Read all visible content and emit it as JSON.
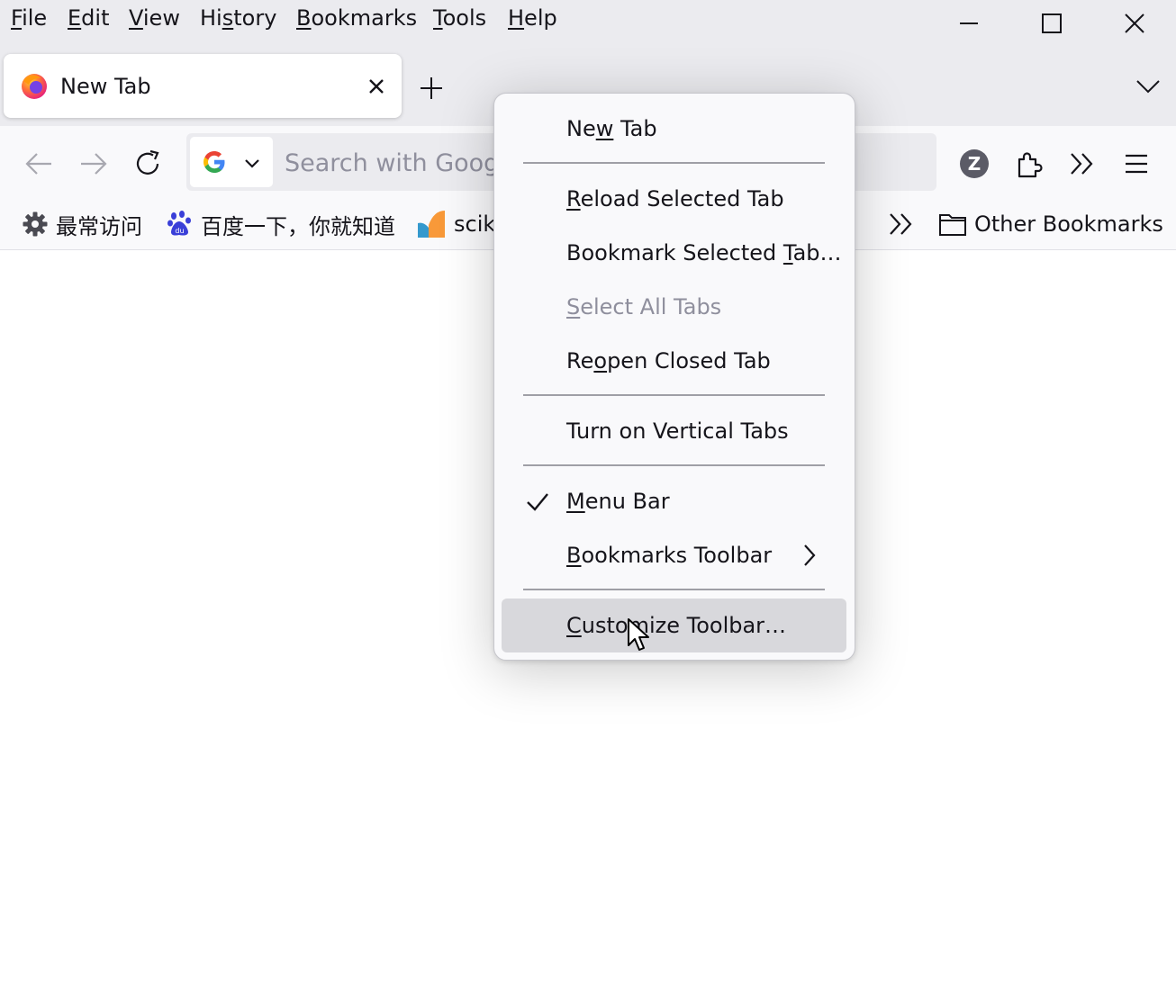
{
  "menubar": {
    "items": [
      {
        "pre": "",
        "u": "F",
        "post": "ile"
      },
      {
        "pre": "",
        "u": "E",
        "post": "dit"
      },
      {
        "pre": "",
        "u": "V",
        "post": "iew"
      },
      {
        "pre": "Hi",
        "u": "s",
        "post": "tory"
      },
      {
        "pre": "",
        "u": "B",
        "post": "ookmarks"
      },
      {
        "pre": "",
        "u": "T",
        "post": "ools"
      },
      {
        "pre": "",
        "u": "H",
        "post": "elp"
      }
    ]
  },
  "tab": {
    "title": "New Tab",
    "icon": "firefox-icon"
  },
  "navbar": {
    "search_placeholder": "Search with Google or enter address",
    "extension_avatar": "Z"
  },
  "bookmarks": {
    "items": [
      {
        "label": "最常访问",
        "icon": "gear-icon"
      },
      {
        "label": "百度一下，你就知道",
        "icon": "baidu-paw-icon"
      },
      {
        "label": "scik",
        "icon": "scikit-logo-icon"
      }
    ],
    "other": "Other Bookmarks"
  },
  "context_menu": {
    "items": [
      {
        "pre": "Ne",
        "u": "w",
        "post": " Tab",
        "disabled": false
      },
      {
        "pre": "",
        "u": "R",
        "post": "eload Selected Tab",
        "disabled": false
      },
      {
        "pre": "Bookmark Selected ",
        "u": "T",
        "post": "ab…",
        "disabled": false
      },
      {
        "pre": "",
        "u": "S",
        "post": "elect All Tabs",
        "disabled": true
      },
      {
        "pre": "Re",
        "u": "o",
        "post": "pen Closed Tab",
        "disabled": false
      },
      {
        "pre": "Turn on Vertical Tabs",
        "u": "",
        "post": "",
        "disabled": false
      },
      {
        "pre": "",
        "u": "M",
        "post": "enu Bar",
        "checked": true
      },
      {
        "pre": "",
        "u": "B",
        "post": "ookmarks Toolbar",
        "submenu": true
      },
      {
        "pre": "",
        "u": "C",
        "post": "ustomize Toolbar…",
        "hovered": true
      }
    ]
  },
  "colors": {
    "accent": "#0061e0",
    "menu_hover": "#d8d8dc",
    "chrome_bg": "#ebebef"
  }
}
